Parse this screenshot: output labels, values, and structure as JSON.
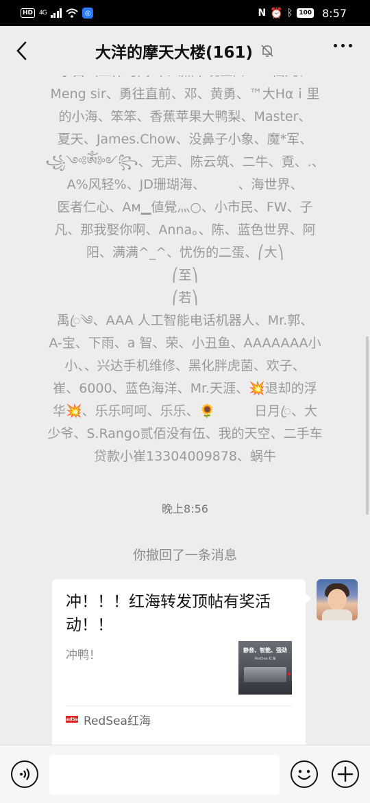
{
  "status_bar": {
    "hd": "HD",
    "signal": "4G",
    "battery": "100",
    "time": "8:57"
  },
  "header": {
    "title": "大洋的摩天大楼(161)"
  },
  "chat": {
    "join_note_lines": [
      "小白（工作时间:早八点半晚五）、Mr.仙九、",
      "Meng sir、勇往直前、邓、黄勇、™大Hαｉ里",
      "的小海、笨笨、香蕉苹果大鸭梨、Master、",
      "夏天、James.Chow、没鼻子小象、魔*军、",
      "꧁༺ༀ༻꧂、无声、陈云筑、二牛、覔、.、",
      "A%风轻%、JD珊瑚海、　　　、海世界、",
      "医者仁心、Aм▁値覺灬○、小市民、FW、子",
      "凡、那我娶你啊、Anna。、陈、蓝色世界、阿",
      "阳、满满^_^、忧伤的二蛋、⎛大⎞",
      "⎛至⎞",
      "⎛若⎞",
      "禹ꦿ༄、AAA 人工智能电话机器人、Mr.郭、",
      "A-宝、下雨、a 智、荣、小丑鱼、AAAAAAA小",
      "小、、兴达手机维修、黑化胖虎菌、欢子、",
      "崔、6000、蓝色海洋、Mr.天涯、💥退却的浮",
      "华💥、乐乐呵呵、乐乐、🌻　　　日月ꦿ、大",
      "少爷、S.Rango贰佰没有伍、我的天空、二手车",
      "贷款小崔13304009878、蜗牛"
    ],
    "time_label": "晚上8:56",
    "recall_note": "你撤回了一条消息",
    "card": {
      "title": "冲！！！红海转发顶帖有奖活动！！",
      "desc": "冲鸭！",
      "thumb_text": "静音、智能、强劲",
      "thumb_sub": "RedSea 红海",
      "source_logo": "RedSea",
      "source": "RedSea红海"
    }
  },
  "input_bar": {
    "placeholder": ""
  }
}
